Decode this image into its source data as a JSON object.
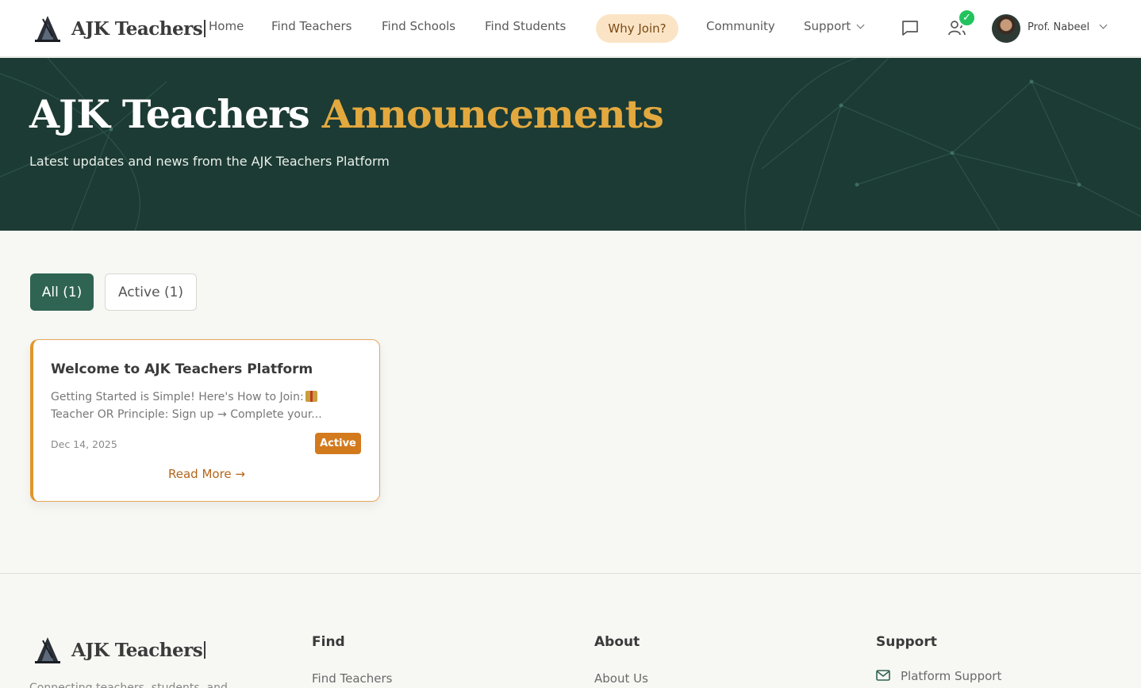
{
  "header": {
    "logo_text": "AJK Teachers",
    "nav": [
      "Home",
      "Find Teachers",
      "Find Schools",
      "Find Students"
    ],
    "why_join": "Why Join?",
    "community": "Community",
    "support": "Support",
    "badge_glyph": "✓",
    "user_name": "Prof. Nabeel"
  },
  "hero": {
    "title_main": "AJK Teachers",
    "title_accent": "Announcements",
    "subtitle": "Latest updates and news from the AJK Teachers Platform"
  },
  "filters": {
    "all": "All (1)",
    "active": "Active (1)"
  },
  "announcement": {
    "title": "Welcome to AJK Teachers Platform",
    "body_line1": "Getting Started is Simple! Here's How to Join:",
    "body_line2": "Teacher OR Principle: Sign up → Complete your...",
    "date": "Dec 14, 2025",
    "status": "Active",
    "read_more": "Read More →"
  },
  "footer": {
    "logo_text": "AJK Teachers",
    "tagline": "Connecting teachers, students, and",
    "find_heading": "Find",
    "find_link": "Find Teachers",
    "about_heading": "About",
    "about_link": "About Us",
    "support_heading": "Support",
    "support_link": "Platform Support"
  },
  "colors": {
    "brand_green": "#2f6452",
    "hero_bg": "#1c3b34",
    "accent_gold": "#e3a93f",
    "status_orange": "#d37a1d"
  },
  "icons": [
    "logo-icon",
    "chevron-down-icon",
    "message-icon",
    "users-icon",
    "check-icon",
    "mail-icon"
  ]
}
